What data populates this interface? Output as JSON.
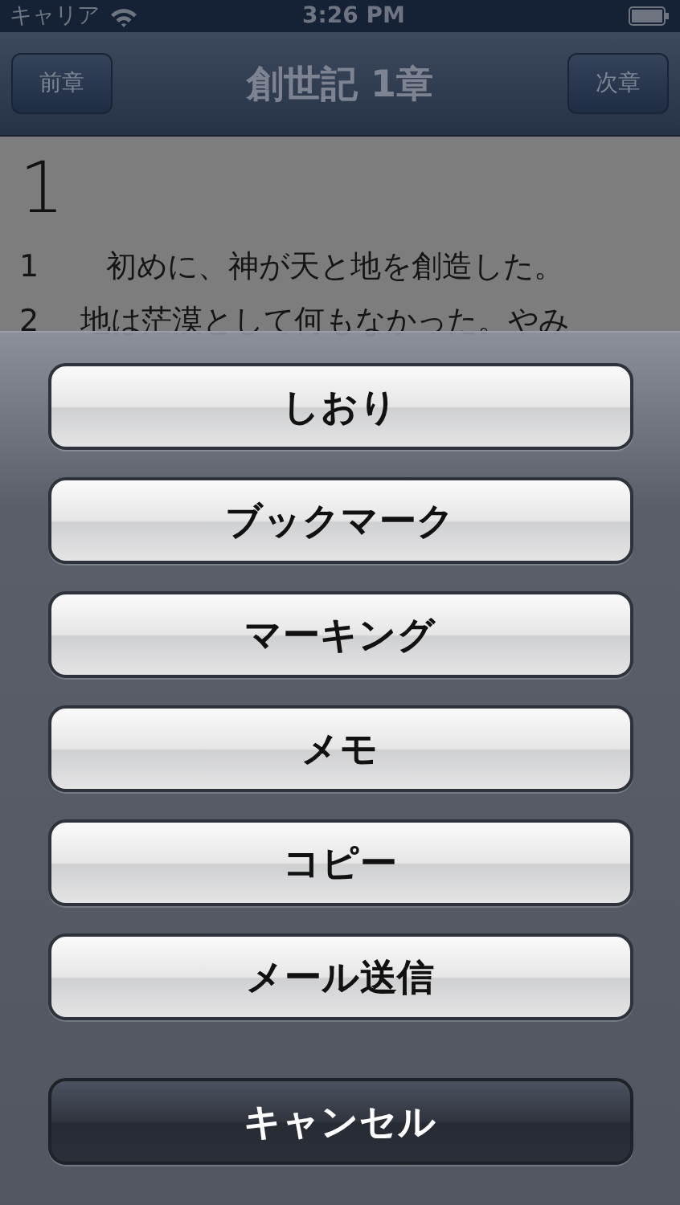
{
  "status_bar": {
    "carrier": "キャリア",
    "time": "3:26 PM"
  },
  "nav_bar": {
    "left_button": "前章",
    "title": "創世記 1章",
    "right_button": "次章"
  },
  "chapter": {
    "number": "1",
    "verses": [
      {
        "number": "1",
        "text": "初めに、神が天と地を創造した。"
      },
      {
        "number": "2",
        "text": "地は茫漠として何もなかった。やみ"
      }
    ]
  },
  "action_sheet": {
    "buttons": [
      {
        "label": "しおり",
        "kind": "default"
      },
      {
        "label": "ブックマーク",
        "kind": "default"
      },
      {
        "label": "マーキング",
        "kind": "default"
      },
      {
        "label": "メモ",
        "kind": "default"
      },
      {
        "label": "コピー",
        "kind": "default"
      },
      {
        "label": "メール送信",
        "kind": "default"
      },
      {
        "label": "キャンセル",
        "kind": "cancel"
      }
    ]
  }
}
